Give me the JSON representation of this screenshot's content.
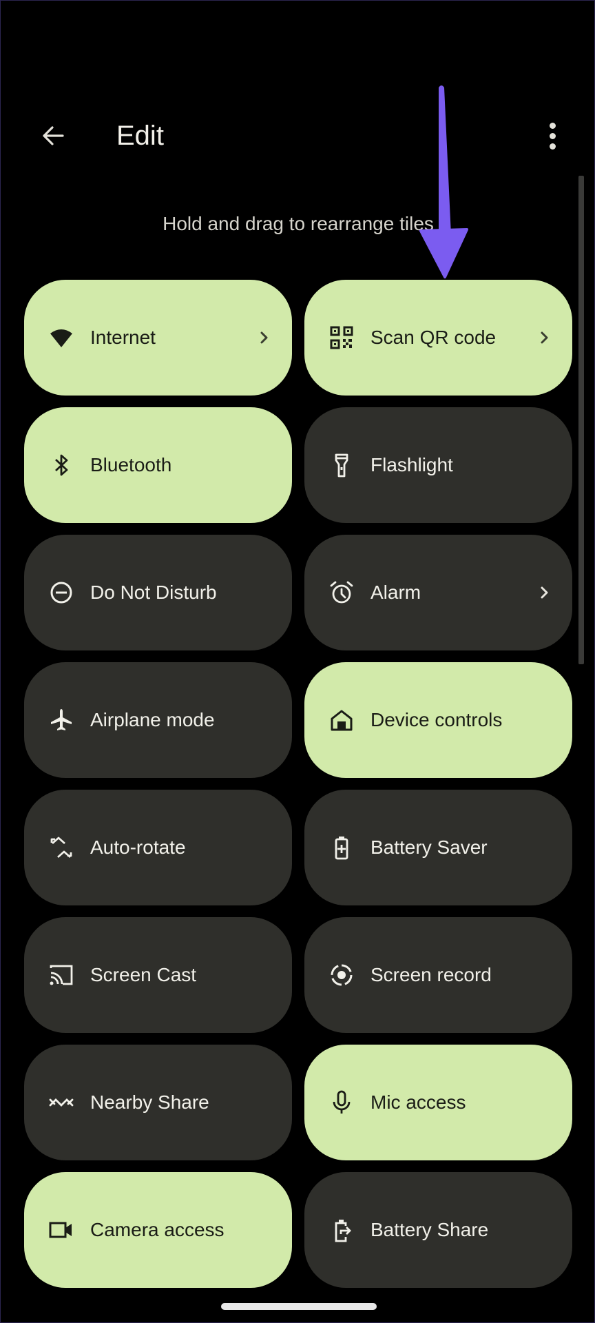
{
  "header": {
    "title": "Edit",
    "back_icon": "arrow-back-icon",
    "menu_icon": "more-vert-icon"
  },
  "hint": "Hold and drag to rearrange tiles",
  "colors": {
    "tile_active": "#d2eaaa",
    "tile_inactive": "#2f2f2b",
    "annotation_arrow": "#7b5cf0",
    "background": "#000000"
  },
  "tiles": [
    {
      "label": "Internet",
      "icon": "wifi-icon",
      "active": true,
      "chevron": true
    },
    {
      "label": "Scan QR code",
      "icon": "qr-code-icon",
      "active": true,
      "chevron": true
    },
    {
      "label": "Bluetooth",
      "icon": "bluetooth-icon",
      "active": true,
      "chevron": false
    },
    {
      "label": "Flashlight",
      "icon": "flashlight-icon",
      "active": false,
      "chevron": false
    },
    {
      "label": "Do Not Disturb",
      "icon": "do-not-disturb-icon",
      "active": false,
      "chevron": false
    },
    {
      "label": "Alarm",
      "icon": "alarm-icon",
      "active": false,
      "chevron": true
    },
    {
      "label": "Airplane mode",
      "icon": "airplane-icon",
      "active": false,
      "chevron": false
    },
    {
      "label": "Device controls",
      "icon": "home-icon",
      "active": true,
      "chevron": false
    },
    {
      "label": "Auto-rotate",
      "icon": "auto-rotate-icon",
      "active": false,
      "chevron": false
    },
    {
      "label": "Battery Saver",
      "icon": "battery-saver-icon",
      "active": false,
      "chevron": false
    },
    {
      "label": "Screen Cast",
      "icon": "cast-icon",
      "active": false,
      "chevron": false
    },
    {
      "label": "Screen record",
      "icon": "screen-record-icon",
      "active": false,
      "chevron": false
    },
    {
      "label": "Nearby Share",
      "icon": "nearby-share-icon",
      "active": false,
      "chevron": false
    },
    {
      "label": "Mic access",
      "icon": "mic-icon",
      "active": true,
      "chevron": false
    },
    {
      "label": "Camera access",
      "icon": "camera-icon",
      "active": true,
      "chevron": false
    },
    {
      "label": "Battery Share",
      "icon": "battery-share-icon",
      "active": false,
      "chevron": false
    }
  ],
  "annotation": {
    "type": "arrow",
    "points_to": "Scan QR code"
  }
}
